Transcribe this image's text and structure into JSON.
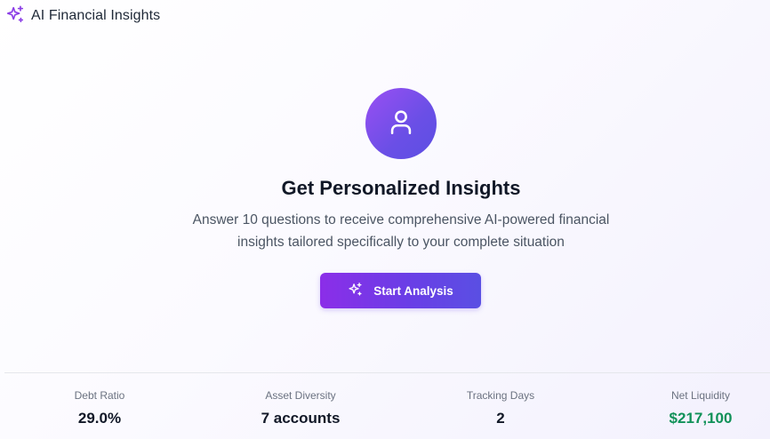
{
  "app": {
    "title": "AI Financial Insights",
    "logo_icon": "sparkles-icon"
  },
  "hero": {
    "icon": "user-icon",
    "title": "Get Personalized Insights",
    "description": "Answer 10 questions to receive comprehensive AI-powered financial insights tailored specifically to your complete situation",
    "cta_label": "Start Analysis",
    "cta_icon": "sparkles-icon"
  },
  "stats": [
    {
      "label": "Debt Ratio",
      "value": "29.0%"
    },
    {
      "label": "Asset Diversity",
      "value": "7 accounts"
    },
    {
      "label": "Tracking Days",
      "value": "2"
    },
    {
      "label": "Net Liquidity",
      "value": "$217,100",
      "color": "#109158"
    }
  ],
  "colors": {
    "accent_start": "#8b2ee8",
    "accent_end": "#5a4fe3",
    "positive": "#109158"
  }
}
